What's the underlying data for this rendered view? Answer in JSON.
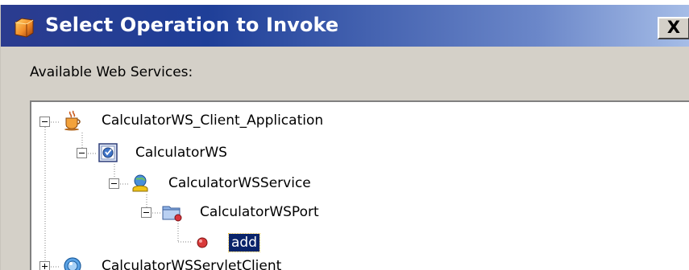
{
  "dialog": {
    "title": "Select Operation to Invoke",
    "close_label": "X",
    "section_label": "Available Web Services:",
    "tree": [
      {
        "label": "CalculatorWS_Client_Application",
        "icon": "coffee-cup-icon",
        "expanded": true
      },
      {
        "label": "CalculatorWS",
        "icon": "web-service-icon",
        "expanded": true
      },
      {
        "label": "CalculatorWSService",
        "icon": "service-globe-icon",
        "expanded": true
      },
      {
        "label": "CalculatorWSPort",
        "icon": "port-folder-icon",
        "expanded": true
      },
      {
        "label": "add",
        "icon": "operation-icon",
        "selected": true
      },
      {
        "label": "CalculatorWSServletClient",
        "icon": "servlet-client-icon",
        "expanded": false
      }
    ]
  },
  "colors": {
    "title_gradient_start": "#1f3f98",
    "title_gradient_end": "#a6bde7",
    "selection": "#0a246a",
    "dialog_face": "#d4d0c8"
  }
}
